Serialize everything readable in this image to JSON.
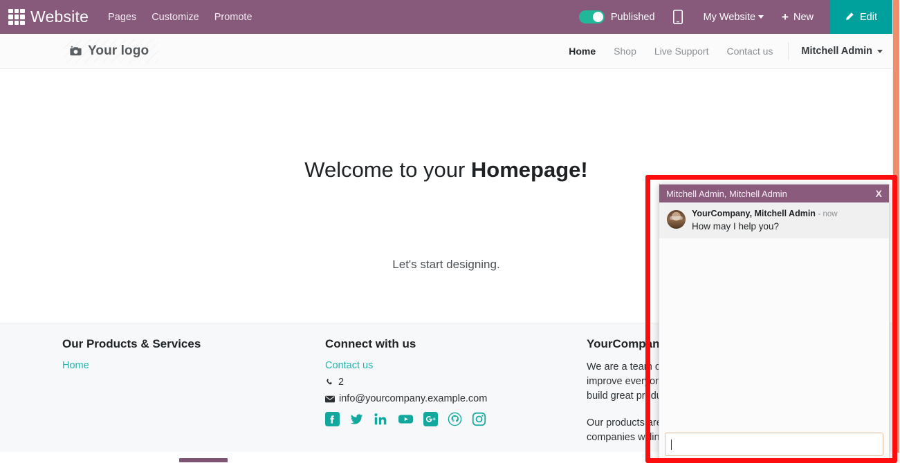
{
  "topbar": {
    "apps_icon": "apps-grid-icon",
    "brand": "Website",
    "menus": [
      "Pages",
      "Customize",
      "Promote"
    ],
    "published_label": "Published",
    "published_state": "on",
    "mobile_icon": "mobile-preview-icon",
    "website_selector": "My Website",
    "new_label": "New",
    "new_icon": "plus-icon",
    "edit_label": "Edit",
    "edit_icon": "pencil-icon",
    "bg_color": "#875A7B",
    "edit_bg_color": "#00A09D",
    "toggle_color": "#21B799"
  },
  "site_header": {
    "logo_text": "Your logo",
    "logo_icon": "camera-icon",
    "nav": [
      {
        "label": "Home",
        "active": true
      },
      {
        "label": "Shop",
        "active": false
      },
      {
        "label": "Live Support",
        "active": false
      },
      {
        "label": "Contact us",
        "active": false
      }
    ],
    "user": "Mitchell Admin"
  },
  "hero": {
    "title_prefix": "Welcome to your ",
    "title_strong": "Homepage!",
    "subtitle": "Let's start designing."
  },
  "footer": {
    "col1": {
      "title": "Our Products & Services",
      "links": [
        "Home"
      ]
    },
    "col2": {
      "title": "Connect with us",
      "contact_link": "Contact us",
      "phone_icon": "phone-icon",
      "phone": "2",
      "email_icon": "envelope-icon",
      "email": "info@yourcompany.example.com",
      "socials": [
        "facebook-icon",
        "twitter-icon",
        "linkedin-icon",
        "youtube-icon",
        "google-plus-icon",
        "github-icon",
        "instagram-icon"
      ],
      "social_color": "#13a89e"
    },
    "col3": {
      "title": "YourCompany",
      "paragraph1": "We are a team of\nimprove everyone\nbuild great produ",
      "paragraph2": "Our products are\ncompanies willing"
    },
    "bg_color": "#f7f8f9",
    "link_color": "#25b3ad"
  },
  "chat": {
    "header_title": "Mitchell Admin, Mitchell Admin",
    "close_label": "X",
    "header_bg": "#8A5B7D",
    "message": {
      "author": "YourCompany, Mitchell Admin",
      "time": "- now",
      "text": "How may I help you?",
      "avatar": "user-avatar"
    },
    "input_value": "",
    "input_placeholder": "",
    "highlight_color": "#fd0d0d"
  },
  "scrollbar": {
    "thumb_color": "#ee8e6b",
    "track_color": "#f1f1f1"
  }
}
